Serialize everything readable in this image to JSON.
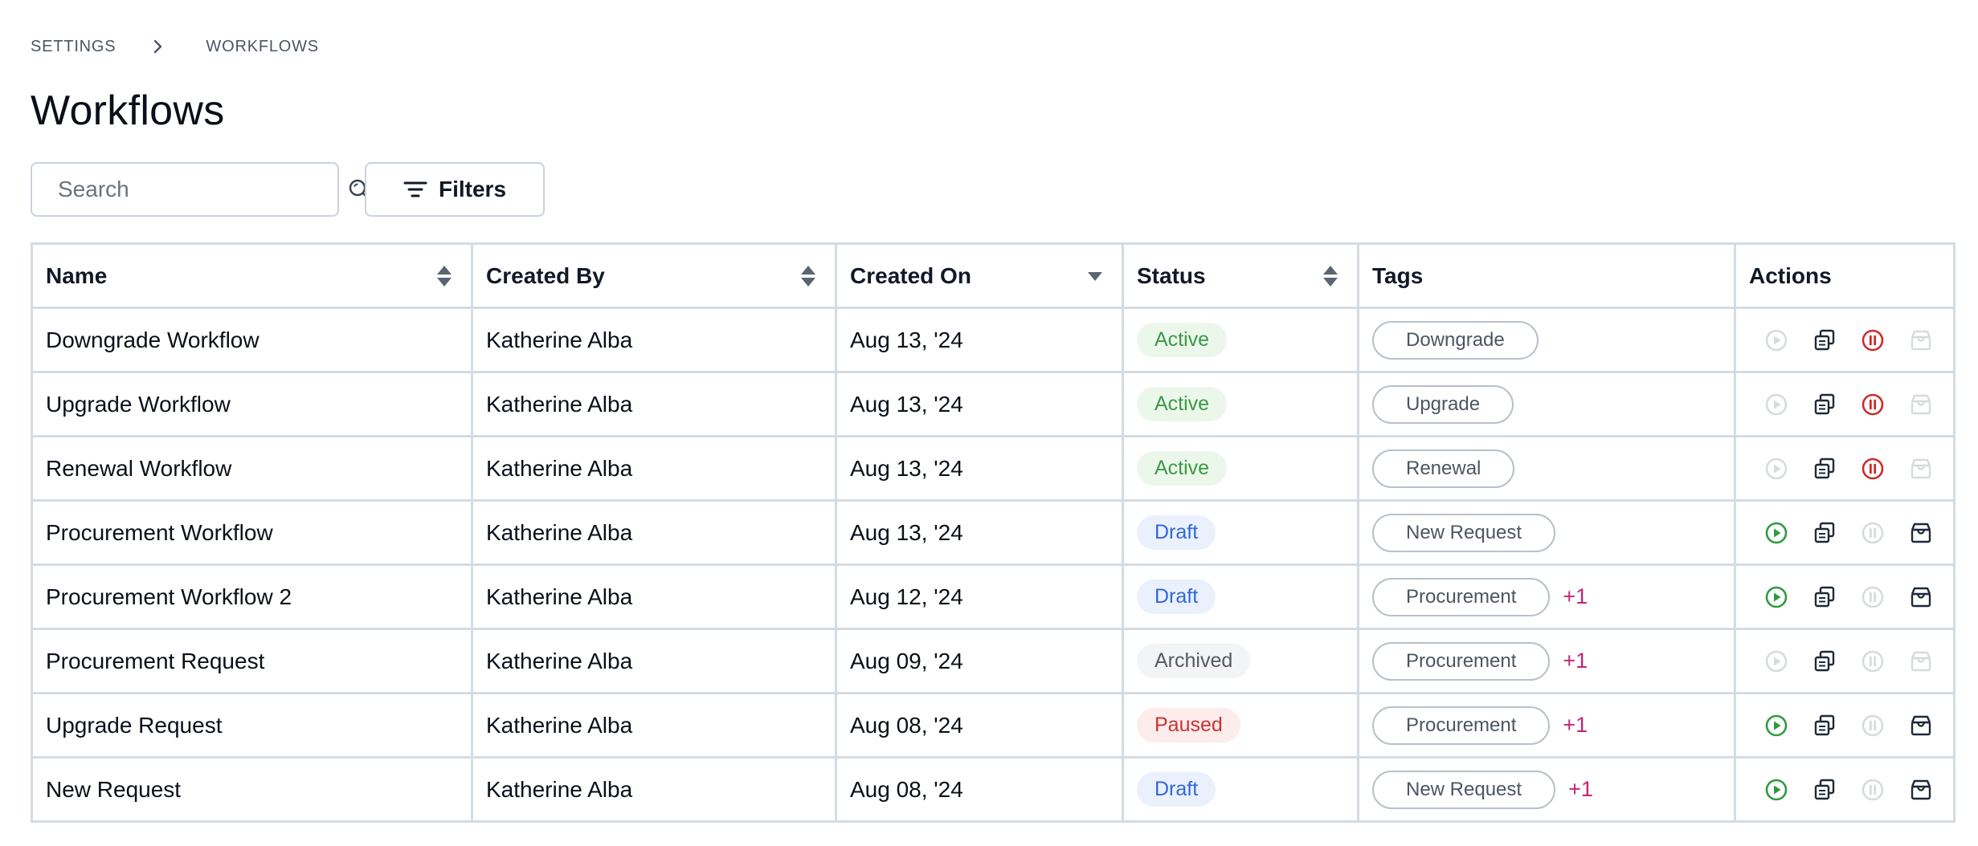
{
  "breadcrumb": {
    "items": [
      "SETTINGS",
      "WORKFLOWS"
    ]
  },
  "page": {
    "title": "Workflows"
  },
  "search": {
    "placeholder": "Search"
  },
  "toolbar": {
    "filters_label": "Filters"
  },
  "table": {
    "columns": [
      {
        "label": "Name",
        "sort": "both"
      },
      {
        "label": "Created By",
        "sort": "both"
      },
      {
        "label": "Created On",
        "sort": "desc"
      },
      {
        "label": "Status",
        "sort": "both"
      },
      {
        "label": "Tags",
        "sort": "none"
      },
      {
        "label": "Actions",
        "sort": "none"
      }
    ],
    "rows": [
      {
        "name": "Downgrade Workflow",
        "created_by": "Katherine Alba",
        "created_on": "Aug 13, '24",
        "status": "Active",
        "tag": "Downgrade",
        "more": "",
        "actions": {
          "run": false,
          "copy": true,
          "pause": true,
          "archive": false
        }
      },
      {
        "name": "Upgrade Workflow",
        "created_by": "Katherine Alba",
        "created_on": "Aug 13, '24",
        "status": "Active",
        "tag": "Upgrade",
        "more": "",
        "actions": {
          "run": false,
          "copy": true,
          "pause": true,
          "archive": false
        }
      },
      {
        "name": "Renewal Workflow",
        "created_by": "Katherine Alba",
        "created_on": "Aug 13, '24",
        "status": "Active",
        "tag": "Renewal",
        "more": "",
        "actions": {
          "run": false,
          "copy": true,
          "pause": true,
          "archive": false
        }
      },
      {
        "name": "Procurement Workflow",
        "created_by": "Katherine Alba",
        "created_on": "Aug 13, '24",
        "status": "Draft",
        "tag": "New Request",
        "more": "",
        "actions": {
          "run": true,
          "copy": true,
          "pause": false,
          "archive": true
        }
      },
      {
        "name": "Procurement Workflow 2",
        "created_by": "Katherine Alba",
        "created_on": "Aug 12, '24",
        "status": "Draft",
        "tag": "Procurement",
        "more": "+1",
        "actions": {
          "run": true,
          "copy": true,
          "pause": false,
          "archive": true
        }
      },
      {
        "name": "Procurement Request",
        "created_by": "Katherine Alba",
        "created_on": "Aug 09, '24",
        "status": "Archived",
        "tag": "Procurement",
        "more": "+1",
        "actions": {
          "run": false,
          "copy": true,
          "pause": false,
          "archive": false
        }
      },
      {
        "name": "Upgrade Request",
        "created_by": "Katherine Alba",
        "created_on": "Aug 08, '24",
        "status": "Paused",
        "tag": "Procurement",
        "more": "+1",
        "actions": {
          "run": true,
          "copy": true,
          "pause": false,
          "archive": true
        }
      },
      {
        "name": "New Request",
        "created_by": "Katherine Alba",
        "created_on": "Aug 08, '24",
        "status": "Draft",
        "tag": "New Request",
        "more": "+1",
        "actions": {
          "run": true,
          "copy": true,
          "pause": false,
          "archive": true
        }
      }
    ]
  },
  "icons": {
    "breadcrumb_separator": "chevron-right-icon",
    "search": "search-icon",
    "filters": "filter-lines-icon",
    "sort_both": "sort-updown-icon",
    "sort_desc": "caret-down-icon",
    "run": "play-circle-icon",
    "copy": "copy-icon",
    "pause": "pause-circle-icon",
    "archive": "archive-box-icon"
  },
  "colors": {
    "run_enabled": "#2e9a3e",
    "pause_enabled": "#cc2b2b",
    "icon_default": "#1f2937",
    "icon_disabled": "#d6dae1",
    "tag_more": "#c02675",
    "active_text": "#3a9a43",
    "active_bg": "#ecf7ec",
    "draft_text": "#3167d6",
    "draft_bg": "#eaf1fd",
    "archived_text": "#525a66",
    "archived_bg": "#f3f4f6",
    "paused_text": "#cc3232",
    "paused_bg": "#fdecec"
  }
}
